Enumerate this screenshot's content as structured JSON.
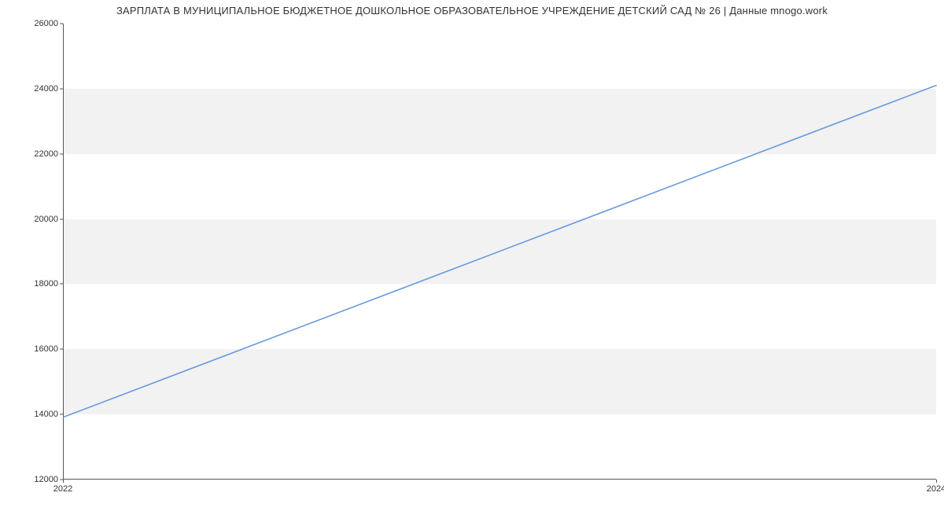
{
  "chart_data": {
    "type": "line",
    "title": "ЗАРПЛАТА В МУНИЦИПАЛЬНОЕ БЮДЖЕТНОЕ ДОШКОЛЬНОЕ ОБРАЗОВАТЕЛЬНОЕ УЧРЕЖДЕНИЕ ДЕТСКИЙ САД № 26 | Данные mnogo.work",
    "xlabel": "",
    "ylabel": "",
    "x": [
      2022,
      2024
    ],
    "values": [
      13900,
      24100
    ],
    "xlim": [
      2022,
      2024
    ],
    "ylim": [
      12000,
      26000
    ],
    "yticks": [
      12000,
      14000,
      16000,
      18000,
      20000,
      22000,
      24000,
      26000
    ],
    "xticks": [
      2022,
      2024
    ],
    "line_color": "#6699dd",
    "band_color": "#f2f2f2"
  }
}
